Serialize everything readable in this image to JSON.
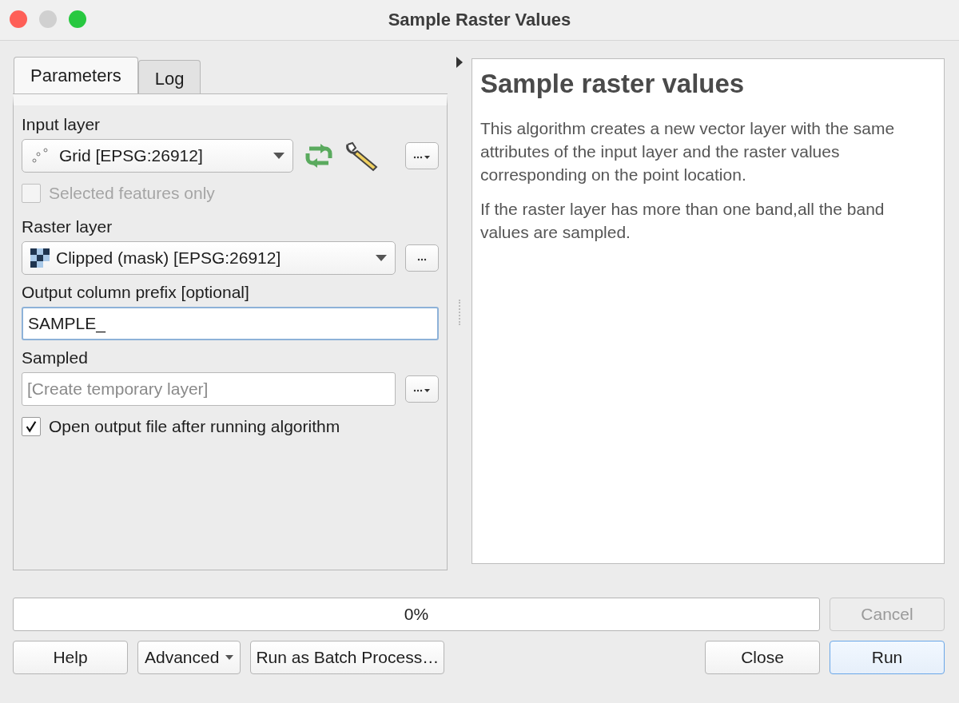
{
  "window": {
    "title": "Sample Raster Values"
  },
  "tabs": [
    {
      "label": "Parameters",
      "selected": true
    },
    {
      "label": "Log",
      "selected": false
    }
  ],
  "input_layer": {
    "label": "Input layer",
    "value": "Grid [EPSG:26912]",
    "selected_only": {
      "label": "Selected features only",
      "checked": false,
      "disabled": true
    }
  },
  "raster_layer": {
    "label": "Raster layer",
    "value": "Clipped (mask) [EPSG:26912]"
  },
  "prefix": {
    "label": "Output column prefix [optional]",
    "value": "SAMPLE_"
  },
  "sampled": {
    "label": "Sampled",
    "placeholder": "[Create temporary layer]"
  },
  "open_output": {
    "label": "Open output file after running algorithm",
    "checked": true,
    "disabled": false
  },
  "help": {
    "title": "Sample raster values",
    "paragraphs": [
      "This algorithm creates a new vector layer with the same attributes of the input layer and the raster values corresponding on the point location.",
      "If the raster layer has more than one band,all the band values are sampled."
    ]
  },
  "progress": {
    "level": 0,
    "reading": "0%"
  },
  "cancel": {
    "label": "Cancel",
    "disabled": true
  },
  "left_buttons": [
    {
      "label": "Help",
      "kind": "plain"
    },
    {
      "label": "Advanced",
      "kind": "menu"
    },
    {
      "label": "Run as Batch Process…",
      "kind": "plain"
    }
  ],
  "right_buttons": [
    {
      "label": "Close",
      "default": false
    },
    {
      "label": "Run",
      "default": true
    }
  ]
}
